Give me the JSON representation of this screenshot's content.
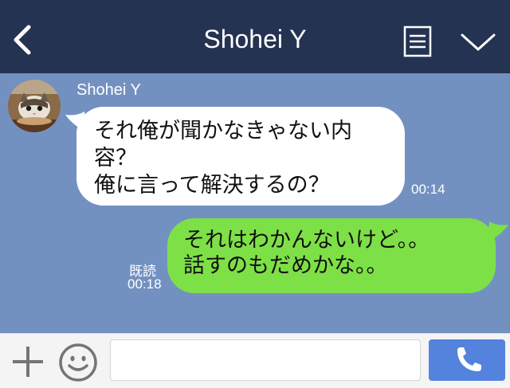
{
  "header": {
    "title": "Shohei Y",
    "back_icon": "chevron-left-icon",
    "menu_icon": "note-icon",
    "collapse_icon": "chevron-down-icon"
  },
  "chat": {
    "incoming": {
      "sender": "Shohei Y",
      "lines": [
        "それ俺が聞かなきゃない内",
        "容？",
        "俺に言って解決するの？"
      ],
      "time": "00:14"
    },
    "outgoing": {
      "lines": [
        "それはわかんないけど。。",
        "話すのもだめかな。。"
      ],
      "read_label": "既読",
      "time": "00:18"
    }
  },
  "input_bar": {
    "plus_icon": "plus-icon",
    "emoji_icon": "smiley-icon",
    "message_value": "",
    "call_icon": "phone-icon"
  },
  "colors": {
    "header_bg": "#243352",
    "chat_bg": "#7391c0",
    "outgoing_bubble": "#7ee047",
    "incoming_bubble": "#ffffff",
    "call_button": "#5483dd"
  }
}
